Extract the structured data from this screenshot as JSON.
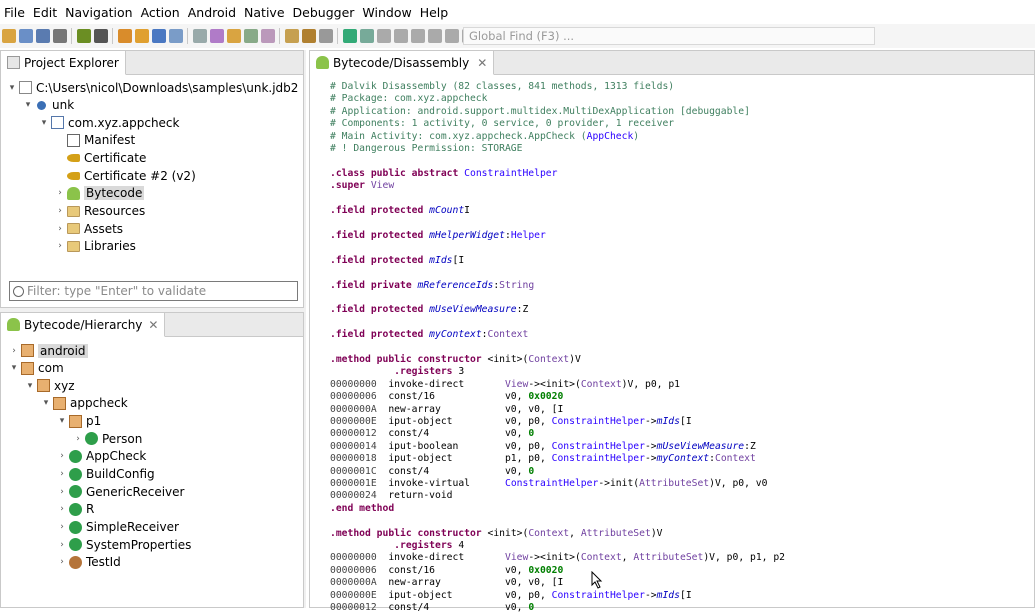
{
  "menu": [
    "File",
    "Edit",
    "Navigation",
    "Action",
    "Android",
    "Native",
    "Debugger",
    "Window",
    "Help"
  ],
  "toolbar": {
    "global_find_placeholder": "Global Find (F3) ..."
  },
  "project_explorer": {
    "tab_label": "Project Explorer",
    "tree": [
      {
        "label": "C:\\Users\\nicol\\Downloads\\samples\\unk.jdb2",
        "depth": 0,
        "arrow": "▾",
        "icon": "file-icon"
      },
      {
        "label": "unk",
        "depth": 1,
        "arrow": "▾",
        "icon": "artifact-icon"
      },
      {
        "label": "com.xyz.appcheck",
        "depth": 2,
        "arrow": "▾",
        "icon": "apk-icon"
      },
      {
        "label": "Manifest",
        "depth": 3,
        "arrow": "",
        "icon": "xml-icon"
      },
      {
        "label": "Certificate",
        "depth": 3,
        "arrow": "",
        "icon": "key-icon"
      },
      {
        "label": "Certificate #2 (v2)",
        "depth": 3,
        "arrow": "",
        "icon": "key-icon"
      },
      {
        "label": "Bytecode",
        "depth": 3,
        "arrow": "›",
        "icon": "android-icon",
        "selected": true
      },
      {
        "label": "Resources",
        "depth": 3,
        "arrow": "›",
        "icon": "folder-icon"
      },
      {
        "label": "Assets",
        "depth": 3,
        "arrow": "›",
        "icon": "folder-icon"
      },
      {
        "label": "Libraries",
        "depth": 3,
        "arrow": "›",
        "icon": "folder-icon"
      }
    ],
    "filter_placeholder": "Filter: type \"Enter\" to validate"
  },
  "hierarchy": {
    "tab_label": "Bytecode/Hierarchy",
    "tree": [
      {
        "label": "android",
        "depth": 0,
        "arrow": "›",
        "icon": "package-icon",
        "selected": true
      },
      {
        "label": "com",
        "depth": 0,
        "arrow": "▾",
        "icon": "package-icon"
      },
      {
        "label": "xyz",
        "depth": 1,
        "arrow": "▾",
        "icon": "package-icon"
      },
      {
        "label": "appcheck",
        "depth": 2,
        "arrow": "▾",
        "icon": "package-icon"
      },
      {
        "label": "p1",
        "depth": 3,
        "arrow": "▾",
        "icon": "package-icon"
      },
      {
        "label": "Person",
        "depth": 4,
        "arrow": "›",
        "icon": "class-icon"
      },
      {
        "label": "AppCheck",
        "depth": 3,
        "arrow": "›",
        "icon": "class-icon"
      },
      {
        "label": "BuildConfig",
        "depth": 3,
        "arrow": "›",
        "icon": "class-icon"
      },
      {
        "label": "GenericReceiver",
        "depth": 3,
        "arrow": "›",
        "icon": "class-icon"
      },
      {
        "label": "R",
        "depth": 3,
        "arrow": "›",
        "icon": "class-icon"
      },
      {
        "label": "SimpleReceiver",
        "depth": 3,
        "arrow": "›",
        "icon": "class-icon"
      },
      {
        "label": "SystemProperties",
        "depth": 3,
        "arrow": "›",
        "icon": "class-icon"
      },
      {
        "label": "TestId",
        "depth": 3,
        "arrow": "›",
        "icon": "enum-icon"
      }
    ]
  },
  "editor": {
    "tab_label": "Bytecode/Disassembly",
    "lines": [
      [
        [
          "cm",
          "# Dalvik Disassembly (82 classes, 841 methods, 1313 fields)"
        ]
      ],
      [
        [
          "cm",
          "# Package: com.xyz.appcheck"
        ]
      ],
      [
        [
          "cm",
          "# Application: android.support.multidex.MultiDexApplication [debuggable]"
        ]
      ],
      [
        [
          "cm",
          "# Components: 1 activity, 0 service, 0 provider, 1 receiver"
        ]
      ],
      [
        [
          "cm",
          "# Main Activity: com.xyz.appcheck.AppCheck ("
        ],
        [
          "ty",
          "AppCheck"
        ],
        [
          "cm",
          ")"
        ]
      ],
      [
        [
          "cm",
          "# ! Dangerous Permission: STORAGE"
        ]
      ],
      [],
      [
        [
          "kw",
          ".class public abstract "
        ],
        [
          "ty",
          "ConstraintHelper"
        ]
      ],
      [
        [
          "kw",
          ".super "
        ],
        [
          "vt",
          "View"
        ]
      ],
      [],
      [
        [
          "kw",
          ".field protected "
        ],
        [
          "fl",
          "mCount"
        ],
        [
          "",
          "I"
        ]
      ],
      [],
      [
        [
          "kw",
          ".field protected "
        ],
        [
          "fl",
          "mHelperWidget"
        ],
        [
          "",
          ":"
        ],
        [
          "ty",
          "Helper"
        ]
      ],
      [],
      [
        [
          "kw",
          ".field protected "
        ],
        [
          "fl",
          "mIds"
        ],
        [
          "",
          "[I"
        ]
      ],
      [],
      [
        [
          "kw",
          ".field private "
        ],
        [
          "fl",
          "mReferenceIds"
        ],
        [
          "",
          ":"
        ],
        [
          "vt",
          "String"
        ]
      ],
      [],
      [
        [
          "kw",
          ".field protected "
        ],
        [
          "fl",
          "mUseViewMeasure"
        ],
        [
          "",
          ":Z"
        ]
      ],
      [],
      [
        [
          "kw",
          ".field protected "
        ],
        [
          "fl",
          "myContext"
        ],
        [
          "",
          ":"
        ],
        [
          "vt",
          "Context"
        ]
      ],
      [],
      [
        [
          "kw",
          ".method public constructor "
        ],
        [
          "",
          "<init>("
        ],
        [
          "vt",
          "Context"
        ],
        [
          "",
          ")V"
        ]
      ],
      [
        [
          "",
          "           "
        ],
        [
          "kw",
          ".registers "
        ],
        [
          "",
          "3"
        ]
      ],
      [
        [
          "ad",
          "00000000  "
        ],
        [
          "",
          "invoke-direct       "
        ],
        [
          "vt",
          "View"
        ],
        [
          "",
          "-><init>("
        ],
        [
          "vt",
          "Context"
        ],
        [
          "",
          ")V, p0, p1"
        ]
      ],
      [
        [
          "ad",
          "00000006  "
        ],
        [
          "",
          "const/16            v0, "
        ],
        [
          "nm",
          "0x0020"
        ]
      ],
      [
        [
          "ad",
          "0000000A  "
        ],
        [
          "",
          "new-array           v0, v0, [I"
        ]
      ],
      [
        [
          "ad",
          "0000000E  "
        ],
        [
          "",
          "iput-object         v0, p0, "
        ],
        [
          "ty",
          "ConstraintHelper"
        ],
        [
          "",
          "->"
        ],
        [
          "fl",
          "mIds"
        ],
        [
          "",
          "[I"
        ]
      ],
      [
        [
          "ad",
          "00000012  "
        ],
        [
          "",
          "const/4             v0, "
        ],
        [
          "nm",
          "0"
        ]
      ],
      [
        [
          "ad",
          "00000014  "
        ],
        [
          "",
          "iput-boolean        v0, p0, "
        ],
        [
          "ty",
          "ConstraintHelper"
        ],
        [
          "",
          "->"
        ],
        [
          "fl",
          "mUseViewMeasure"
        ],
        [
          "",
          ":Z"
        ]
      ],
      [
        [
          "ad",
          "00000018  "
        ],
        [
          "",
          "iput-object         p1, p0, "
        ],
        [
          "ty",
          "ConstraintHelper"
        ],
        [
          "",
          "->"
        ],
        [
          "fl",
          "myContext"
        ],
        [
          "",
          ":"
        ],
        [
          "vt",
          "Context"
        ]
      ],
      [
        [
          "ad",
          "0000001C  "
        ],
        [
          "",
          "const/4             v0, "
        ],
        [
          "nm",
          "0"
        ]
      ],
      [
        [
          "ad",
          "0000001E  "
        ],
        [
          "",
          "invoke-virtual      "
        ],
        [
          "ty",
          "ConstraintHelper"
        ],
        [
          "",
          "->init("
        ],
        [
          "vt",
          "AttributeSet"
        ],
        [
          "",
          ")V, p0, v0"
        ]
      ],
      [
        [
          "ad",
          "00000024  "
        ],
        [
          "",
          "return-void"
        ]
      ],
      [
        [
          "kw",
          ".end method"
        ]
      ],
      [],
      [
        [
          "kw",
          ".method public constructor "
        ],
        [
          "",
          "<init>("
        ],
        [
          "vt",
          "Context"
        ],
        [
          "",
          ", "
        ],
        [
          "vt",
          "AttributeSet"
        ],
        [
          "",
          ")V"
        ]
      ],
      [
        [
          "",
          "           "
        ],
        [
          "kw",
          ".registers "
        ],
        [
          "",
          "4"
        ]
      ],
      [
        [
          "ad",
          "00000000  "
        ],
        [
          "",
          "invoke-direct       "
        ],
        [
          "vt",
          "View"
        ],
        [
          "",
          "-><init>("
        ],
        [
          "vt",
          "Context"
        ],
        [
          "",
          ", "
        ],
        [
          "vt",
          "AttributeSet"
        ],
        [
          "",
          ")V, p0, p1, p2"
        ]
      ],
      [
        [
          "ad",
          "00000006  "
        ],
        [
          "",
          "const/16            v0, "
        ],
        [
          "nm",
          "0x0020"
        ]
      ],
      [
        [
          "ad",
          "0000000A  "
        ],
        [
          "",
          "new-array           v0, v0, [I"
        ]
      ],
      [
        [
          "ad",
          "0000000E  "
        ],
        [
          "",
          "iput-object         v0, p0, "
        ],
        [
          "ty",
          "ConstraintHelper"
        ],
        [
          "",
          "->"
        ],
        [
          "fl",
          "mIds"
        ],
        [
          "",
          "[I"
        ]
      ],
      [
        [
          "ad",
          "00000012  "
        ],
        [
          "",
          "const/4             v0, "
        ],
        [
          "nm",
          "0"
        ]
      ]
    ]
  },
  "colors": {
    "accent": "#3875d7",
    "selection": "#d9d9d9",
    "comment": "#3f7f5f",
    "keyword": "#7f0055"
  }
}
